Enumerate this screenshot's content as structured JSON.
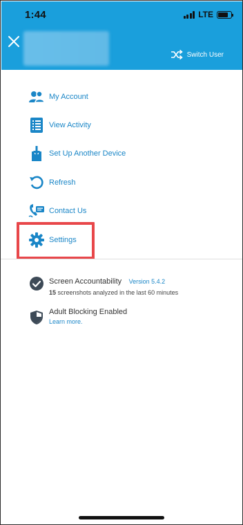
{
  "status_bar": {
    "time": "1:44",
    "network": "LTE",
    "battery_level": 0.75
  },
  "header": {
    "switch_user_label": "Switch User",
    "accent_color": "#1a9fdc"
  },
  "menu": {
    "items": [
      {
        "label": "My Account",
        "icon": "account-icon"
      },
      {
        "label": "View Activity",
        "icon": "activity-list-icon"
      },
      {
        "label": "Set Up Another Device",
        "icon": "download-device-icon"
      },
      {
        "label": "Refresh",
        "icon": "refresh-icon"
      },
      {
        "label": "Contact Us",
        "icon": "contact-icon"
      },
      {
        "label": "Settings",
        "icon": "gear-icon"
      }
    ],
    "highlight_color": "#e8474a"
  },
  "info": {
    "accountability": {
      "title": "Screen Accountability",
      "version": "Version 5.4.2",
      "count": "15",
      "sub": " screenshots analyzed in the last 60 minutes"
    },
    "blocking": {
      "title": "Adult Blocking Enabled",
      "learn_more": "Learn more."
    }
  }
}
